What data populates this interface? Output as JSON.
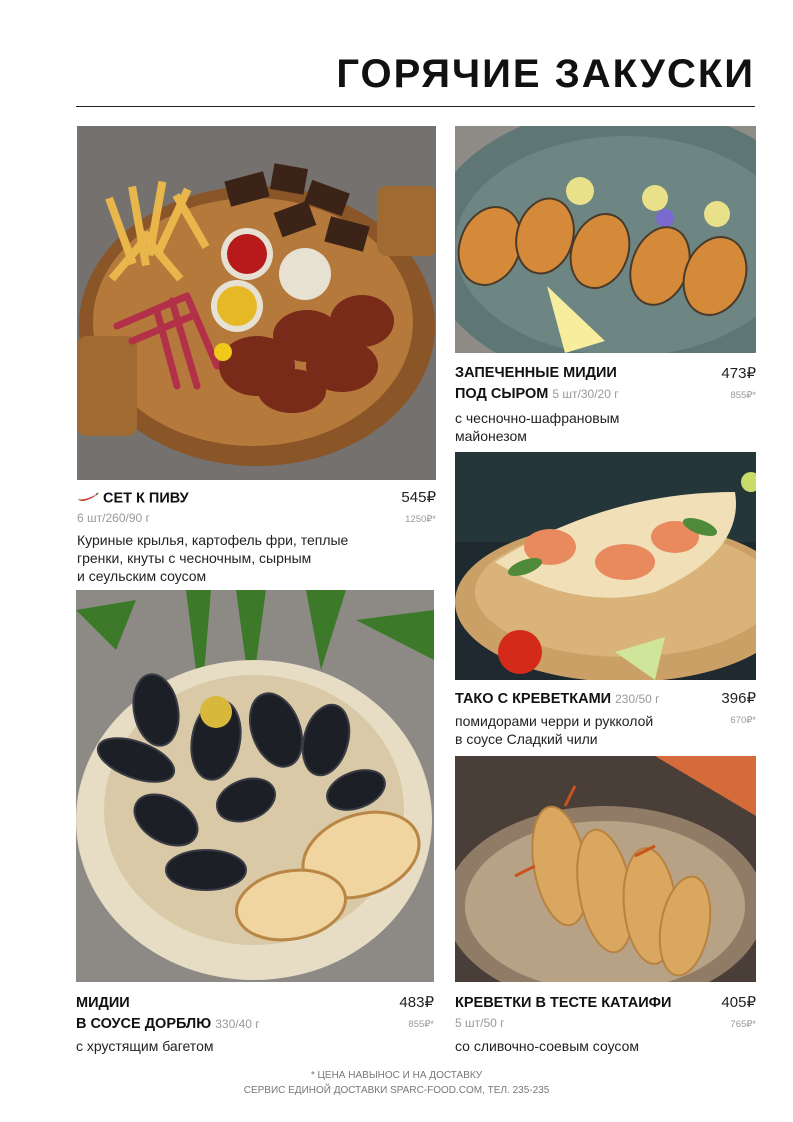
{
  "page": {
    "title": "ГОРЯЧИЕ ЗАКУСКИ"
  },
  "items": [
    {
      "name": "СЕТ К ПИВУ",
      "spicy": true,
      "weight": "6 шт/260/90 г",
      "price": "545₽",
      "delivery_price": "1250₽*",
      "description": [
        "Куриные крылья, картофель фри, теплые",
        "гренки, кнуты с чесночным, сырным",
        "и сеульским соусом"
      ]
    },
    {
      "name_lines": [
        "ЗАПЕЧЕННЫЕ МИДИИ",
        "ПОД СЫРОМ"
      ],
      "weight": "5 шт/30/20 г",
      "price": "473₽",
      "delivery_price": "855₽*",
      "description": [
        "с чесночно-шафрановым",
        "майонезом"
      ]
    },
    {
      "name": "ТАКО С КРЕВЕТКАМИ",
      "weight": "230/50 г",
      "price": "396₽",
      "delivery_price": "670₽*",
      "description": [
        "помидорами черри и рукколой",
        "в соусе Сладкий чили"
      ]
    },
    {
      "name_lines": [
        "МИДИИ",
        "В СОУСЕ ДОРБЛЮ"
      ],
      "weight": "330/40 г",
      "price": "483₽",
      "delivery_price": "855₽*",
      "description": [
        "с хрустящим багетом"
      ]
    },
    {
      "name": "КРЕВЕТКИ В ТЕСТЕ КАТАИФИ",
      "weight": "5 шт/50 г",
      "price": "405₽",
      "delivery_price": "765₽*",
      "description": [
        "со сливочно-соевым соусом"
      ]
    }
  ],
  "footer": {
    "line1": "* ЦЕНА НАВЫНОС И НА ДОСТАВКУ",
    "line2": "СЕРВИС ЕДИНОЙ ДОСТАВКИ SPARC-FOOD.COM, ТЕЛ. 235-235"
  },
  "icons": {
    "spicy": "chili-pepper-icon"
  },
  "colors": {
    "chili": "#c8311e"
  }
}
